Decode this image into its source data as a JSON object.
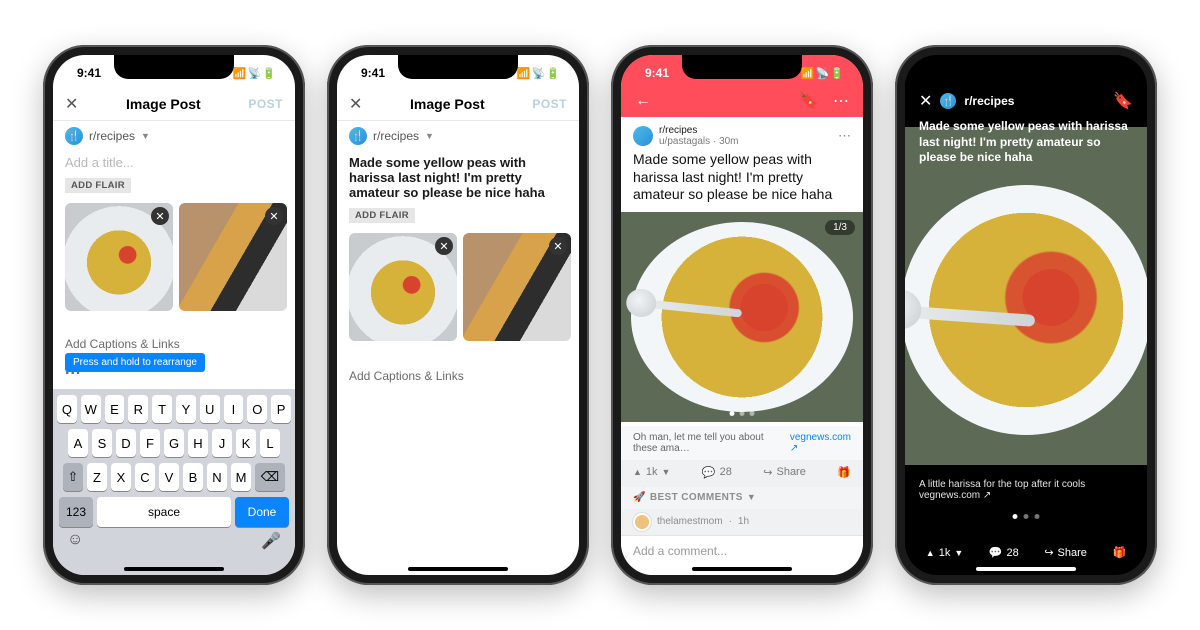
{
  "status": {
    "time": "9:41"
  },
  "compose": {
    "header_title": "Image Post",
    "post_button": "POST",
    "subreddit": "r/recipes",
    "title_placeholder": "Add a title...",
    "filled_title": "Made some yellow peas with harissa last night! I'm pretty amateur so please be nice haha",
    "add_flair": "ADD FLAIR",
    "tooltip": "Press and hold to rearrange",
    "captions_link": "Add Captions & Links",
    "dots": "..."
  },
  "keyboard": {
    "row1": [
      "Q",
      "W",
      "E",
      "R",
      "T",
      "Y",
      "U",
      "I",
      "O",
      "P"
    ],
    "row2": [
      "A",
      "S",
      "D",
      "F",
      "G",
      "H",
      "J",
      "K",
      "L"
    ],
    "row3": [
      "Z",
      "X",
      "C",
      "V",
      "B",
      "N",
      "M"
    ],
    "numbers": "123",
    "space": "space",
    "done": "Done"
  },
  "feed": {
    "subreddit": "r/recipes",
    "author": "u/pastagals",
    "age": "30m",
    "title": "Made some yellow peas with harissa last night! I'm pretty amateur so please be nice haha",
    "counter": "1/3",
    "caption_excerpt": "Oh man, let me tell you about these ama…",
    "link_host": "vegnews.com",
    "upvotes": "1k",
    "comments": "28",
    "share": "Share",
    "best_comments": "BEST COMMENTS",
    "commenter": "thelamestmom",
    "comment_age": "1h",
    "add_comment": "Add a comment..."
  },
  "viewer": {
    "subreddit": "r/recipes",
    "title": "Made some yellow peas with harissa last night! I'm pretty amateur so please be nice haha",
    "caption": "A little harissa for the top after it cools",
    "link_host": "vegnews.com",
    "upvotes": "1k",
    "comments": "28",
    "share": "Share"
  }
}
